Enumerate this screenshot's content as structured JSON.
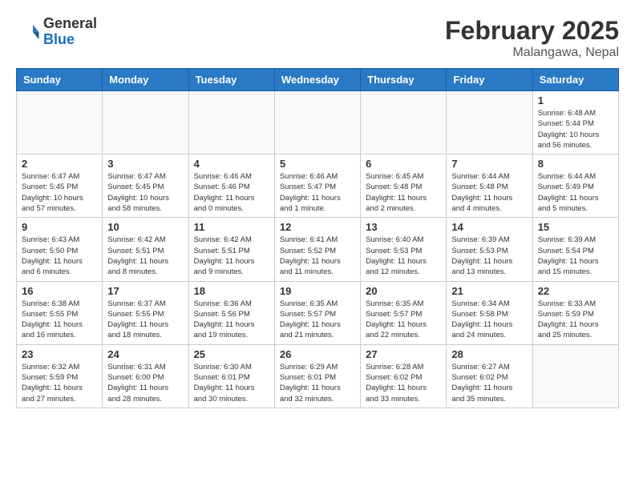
{
  "header": {
    "logo_general": "General",
    "logo_blue": "Blue",
    "month_year": "February 2025",
    "location": "Malangawa, Nepal"
  },
  "weekdays": [
    "Sunday",
    "Monday",
    "Tuesday",
    "Wednesday",
    "Thursday",
    "Friday",
    "Saturday"
  ],
  "weeks": [
    [
      {
        "day": "",
        "info": ""
      },
      {
        "day": "",
        "info": ""
      },
      {
        "day": "",
        "info": ""
      },
      {
        "day": "",
        "info": ""
      },
      {
        "day": "",
        "info": ""
      },
      {
        "day": "",
        "info": ""
      },
      {
        "day": "1",
        "info": "Sunrise: 6:48 AM\nSunset: 5:44 PM\nDaylight: 10 hours and 56 minutes."
      }
    ],
    [
      {
        "day": "2",
        "info": "Sunrise: 6:47 AM\nSunset: 5:45 PM\nDaylight: 10 hours and 57 minutes."
      },
      {
        "day": "3",
        "info": "Sunrise: 6:47 AM\nSunset: 5:45 PM\nDaylight: 10 hours and 58 minutes."
      },
      {
        "day": "4",
        "info": "Sunrise: 6:46 AM\nSunset: 5:46 PM\nDaylight: 11 hours and 0 minutes."
      },
      {
        "day": "5",
        "info": "Sunrise: 6:46 AM\nSunset: 5:47 PM\nDaylight: 11 hours and 1 minute."
      },
      {
        "day": "6",
        "info": "Sunrise: 6:45 AM\nSunset: 5:48 PM\nDaylight: 11 hours and 2 minutes."
      },
      {
        "day": "7",
        "info": "Sunrise: 6:44 AM\nSunset: 5:48 PM\nDaylight: 11 hours and 4 minutes."
      },
      {
        "day": "8",
        "info": "Sunrise: 6:44 AM\nSunset: 5:49 PM\nDaylight: 11 hours and 5 minutes."
      }
    ],
    [
      {
        "day": "9",
        "info": "Sunrise: 6:43 AM\nSunset: 5:50 PM\nDaylight: 11 hours and 6 minutes."
      },
      {
        "day": "10",
        "info": "Sunrise: 6:42 AM\nSunset: 5:51 PM\nDaylight: 11 hours and 8 minutes."
      },
      {
        "day": "11",
        "info": "Sunrise: 6:42 AM\nSunset: 5:51 PM\nDaylight: 11 hours and 9 minutes."
      },
      {
        "day": "12",
        "info": "Sunrise: 6:41 AM\nSunset: 5:52 PM\nDaylight: 11 hours and 11 minutes."
      },
      {
        "day": "13",
        "info": "Sunrise: 6:40 AM\nSunset: 5:53 PM\nDaylight: 11 hours and 12 minutes."
      },
      {
        "day": "14",
        "info": "Sunrise: 6:39 AM\nSunset: 5:53 PM\nDaylight: 11 hours and 13 minutes."
      },
      {
        "day": "15",
        "info": "Sunrise: 6:39 AM\nSunset: 5:54 PM\nDaylight: 11 hours and 15 minutes."
      }
    ],
    [
      {
        "day": "16",
        "info": "Sunrise: 6:38 AM\nSunset: 5:55 PM\nDaylight: 11 hours and 16 minutes."
      },
      {
        "day": "17",
        "info": "Sunrise: 6:37 AM\nSunset: 5:55 PM\nDaylight: 11 hours and 18 minutes."
      },
      {
        "day": "18",
        "info": "Sunrise: 6:36 AM\nSunset: 5:56 PM\nDaylight: 11 hours and 19 minutes."
      },
      {
        "day": "19",
        "info": "Sunrise: 6:35 AM\nSunset: 5:57 PM\nDaylight: 11 hours and 21 minutes."
      },
      {
        "day": "20",
        "info": "Sunrise: 6:35 AM\nSunset: 5:57 PM\nDaylight: 11 hours and 22 minutes."
      },
      {
        "day": "21",
        "info": "Sunrise: 6:34 AM\nSunset: 5:58 PM\nDaylight: 11 hours and 24 minutes."
      },
      {
        "day": "22",
        "info": "Sunrise: 6:33 AM\nSunset: 5:59 PM\nDaylight: 11 hours and 25 minutes."
      }
    ],
    [
      {
        "day": "23",
        "info": "Sunrise: 6:32 AM\nSunset: 5:59 PM\nDaylight: 11 hours and 27 minutes."
      },
      {
        "day": "24",
        "info": "Sunrise: 6:31 AM\nSunset: 6:00 PM\nDaylight: 11 hours and 28 minutes."
      },
      {
        "day": "25",
        "info": "Sunrise: 6:30 AM\nSunset: 6:01 PM\nDaylight: 11 hours and 30 minutes."
      },
      {
        "day": "26",
        "info": "Sunrise: 6:29 AM\nSunset: 6:01 PM\nDaylight: 11 hours and 32 minutes."
      },
      {
        "day": "27",
        "info": "Sunrise: 6:28 AM\nSunset: 6:02 PM\nDaylight: 11 hours and 33 minutes."
      },
      {
        "day": "28",
        "info": "Sunrise: 6:27 AM\nSunset: 6:02 PM\nDaylight: 11 hours and 35 minutes."
      },
      {
        "day": "",
        "info": ""
      }
    ]
  ]
}
